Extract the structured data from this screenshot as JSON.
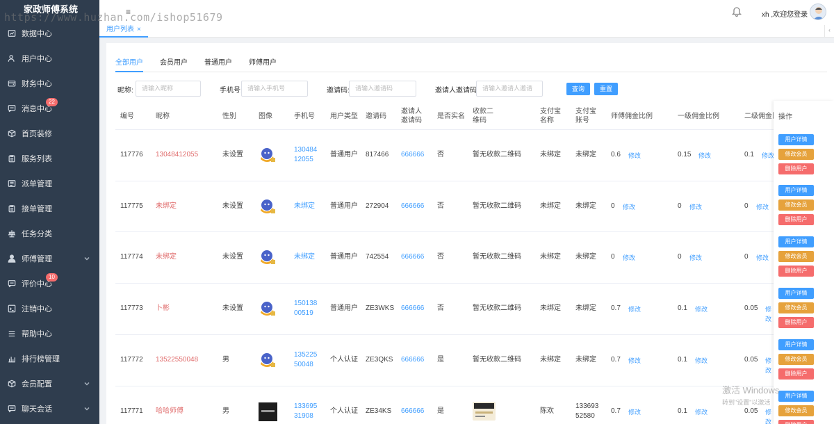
{
  "app": {
    "title": "家政师傅系统"
  },
  "watermark": "https://www.huzhan.com/ishop51679",
  "sidebar": {
    "items": [
      {
        "label": "数据中心",
        "icon": "chart-icon"
      },
      {
        "label": "用户中心",
        "icon": "user-icon"
      },
      {
        "label": "财务中心",
        "icon": "wallet-icon"
      },
      {
        "label": "消息中心",
        "icon": "message-icon",
        "badge": "22"
      },
      {
        "label": "首页装修",
        "icon": "box-icon"
      },
      {
        "label": "服务列表",
        "icon": "clipboard-icon"
      },
      {
        "label": "派单管理",
        "icon": "list-icon"
      },
      {
        "label": "接单管理",
        "icon": "clipboard-icon"
      },
      {
        "label": "任务分类",
        "icon": "scale-icon"
      },
      {
        "label": "师傅管理",
        "icon": "person-icon",
        "expandable": true
      },
      {
        "label": "评价中心",
        "icon": "message-icon",
        "badge": "10"
      },
      {
        "label": "注销中心",
        "icon": "logout-icon"
      },
      {
        "label": "帮助中心",
        "icon": "menu-icon"
      },
      {
        "label": "排行榜管理",
        "icon": "bar-chart-icon"
      },
      {
        "label": "会员配置",
        "icon": "box-icon",
        "expandable": true
      },
      {
        "label": "聊天会话",
        "icon": "message-icon",
        "expandable": true
      }
    ]
  },
  "topbar": {
    "welcome": "xh ,欢迎您登录",
    "hamburger": "≡"
  },
  "tabbar": {
    "active_tab": "用户列表",
    "close": "×"
  },
  "filter_tabs": [
    "全部用户",
    "会员用户",
    "普通用户",
    "师傅用户"
  ],
  "filters": {
    "nickname_label": "昵称:",
    "nickname_placeholder": "请输入昵称",
    "phone_label": "手机号:",
    "phone_placeholder": "请输入手机号",
    "invite_label": "邀请码:",
    "invite_placeholder": "请输入邀请码",
    "inviter_label": "邀请人邀请码:",
    "inviter_placeholder": "请输入邀请人邀请",
    "query_button": "查询",
    "reset_button": "重置"
  },
  "table": {
    "columns": [
      "编号",
      "昵称",
      "性别",
      "图像",
      "手机号",
      "用户类型",
      "邀请码",
      "邀请人邀请码",
      "是否实名",
      "收款二维码",
      "支付宝名称",
      "支付宝账号",
      "师傅佣金比例",
      "一级佣金比例",
      "二级佣金比",
      "操作"
    ],
    "modify_label": "修改",
    "actions": {
      "detail": "用户详情",
      "member": "修改会员",
      "delete": "删除用户"
    },
    "rows": [
      {
        "id": "117776",
        "nickname": "13048412055",
        "gender": "未设置",
        "phone": "13048412055",
        "type": "普通用户",
        "invite": "817466",
        "inviter": "666666",
        "verified": "否",
        "qr": "暂无收款二维码",
        "alipay_name": "未绑定",
        "alipay_acct": "未绑定",
        "master": "0.6",
        "lvl1": "0.15",
        "lvl2": "0.1"
      },
      {
        "id": "117775",
        "nickname": "未绑定",
        "gender": "未设置",
        "phone": "未绑定",
        "type": "普通用户",
        "invite": "272904",
        "inviter": "666666",
        "verified": "否",
        "qr": "暂无收款二维码",
        "alipay_name": "未绑定",
        "alipay_acct": "未绑定",
        "master": "0",
        "lvl1": "0",
        "lvl2": "0"
      },
      {
        "id": "117774",
        "nickname": "未绑定",
        "gender": "未设置",
        "phone": "未绑定",
        "type": "普通用户",
        "invite": "742554",
        "inviter": "666666",
        "verified": "否",
        "qr": "暂无收款二维码",
        "alipay_name": "未绑定",
        "alipay_acct": "未绑定",
        "master": "0",
        "lvl1": "0",
        "lvl2": "0"
      },
      {
        "id": "117773",
        "nickname": "卜彬",
        "gender": "未设置",
        "phone": "15013800519",
        "type": "普通用户",
        "invite": "ZE3WKS",
        "inviter": "666666",
        "verified": "否",
        "qr": "暂无收款二维码",
        "alipay_name": "未绑定",
        "alipay_acct": "未绑定",
        "master": "0.7",
        "lvl1": "0.1",
        "lvl2": "0.05"
      },
      {
        "id": "117772",
        "nickname": "13522550048",
        "gender": "男",
        "phone": "13522550048",
        "type": "个人认证",
        "invite": "ZE3QKS",
        "inviter": "666666",
        "verified": "是",
        "qr": "暂无收款二维码",
        "alipay_name": "未绑定",
        "alipay_acct": "未绑定",
        "master": "0.7",
        "lvl1": "0.1",
        "lvl2": "0.05"
      },
      {
        "id": "117771",
        "nickname": "哈哈师傅",
        "gender": "男",
        "phone": "13369531908",
        "type": "个人认证",
        "invite": "ZE34KS",
        "inviter": "666666",
        "verified": "是",
        "qr": "",
        "alipay_name": "陈欢",
        "alipay_acct": "13369352580",
        "master": "0.7",
        "lvl1": "0.1",
        "lvl2": "0.05"
      }
    ]
  },
  "windows_watermark": {
    "line1": "激活 Windows",
    "line2": "转到\"设置\"以激活"
  },
  "colors": {
    "sidebar": "#2f3d4e",
    "primary": "#409eff",
    "warning": "#e6a23c",
    "danger": "#f56c6c"
  }
}
